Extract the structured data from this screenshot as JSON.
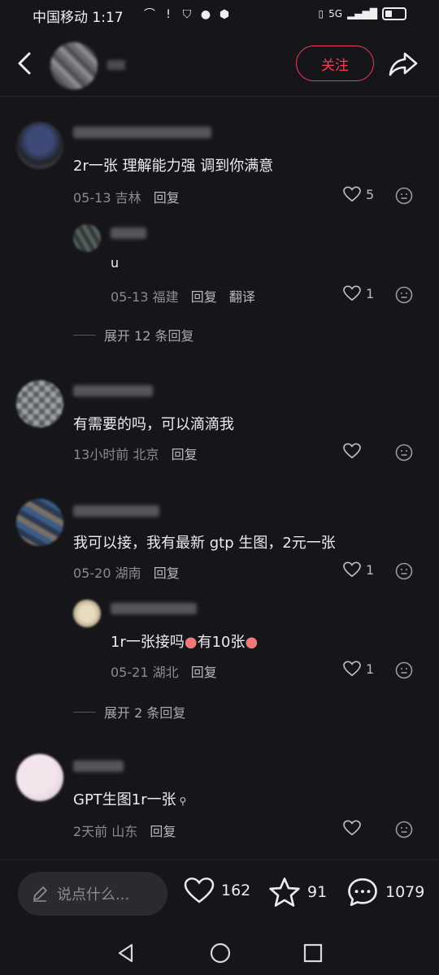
{
  "status_bar": {
    "carrier_time": "中国移动 1:17",
    "network": "5G"
  },
  "header": {
    "follow_label": "关注"
  },
  "comments": [
    {
      "text": "2r一张 理解能力强 调到你满意",
      "date": "05-13",
      "location": "吉林",
      "reply_label": "回复",
      "likes": "5"
    },
    {
      "text": "u",
      "date": "05-13",
      "location": "福建",
      "reply_label": "回复",
      "translate_label": "翻译",
      "likes": "1"
    },
    {
      "text": "有需要的吗，可以滴滴我",
      "date": "13小时前",
      "location": "北京",
      "reply_label": "回复",
      "likes": ""
    },
    {
      "text": "我可以接，我有最新 gtp 生图，2元一张",
      "date": "05-20",
      "location": "湖南",
      "reply_label": "回复",
      "likes": "1"
    },
    {
      "text_a": "1r一张接吗",
      "text_b": "有10张",
      "date": "05-21",
      "location": "湖北",
      "reply_label": "回复",
      "likes": "1"
    },
    {
      "text": "GPT生图1r一张",
      "date": "2天前",
      "location": "山东",
      "reply_label": "回复",
      "likes": ""
    }
  ],
  "expand": [
    {
      "label": "展开 12 条回复"
    },
    {
      "label": "展开 2 条回复"
    }
  ],
  "bottom_bar": {
    "input_placeholder": "说点什么...",
    "likes": "162",
    "favorites": "91",
    "comments": "1079"
  },
  "colors": {
    "background": "#16161a",
    "accent": "#f23c5a"
  }
}
